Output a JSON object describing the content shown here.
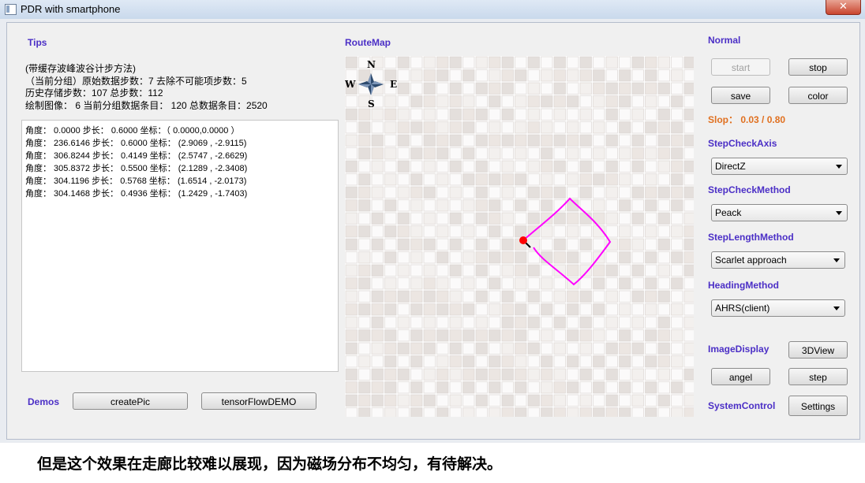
{
  "window": {
    "title": "PDR  with smartphone",
    "close_symbol": "✕"
  },
  "tips": {
    "label": "Tips",
    "lines": [
      "(带缓存波峰波谷计步方法)",
      "（当前分组）原始数据步数：7    去除不可能项步数：5",
      "历史存储步数：107     总步数：112",
      "绘制图像： 6     当前分组数据条目： 120     总数据条目：2520"
    ]
  },
  "log": {
    "lines": [
      "角度： 0.0000  步长： 0.6000  坐标：（ 0.0000,0.0000 ）",
      "角度： 236.6146  步长： 0.6000  坐标： (2.9069 , -2.9115)",
      "角度： 306.8244  步长： 0.4149  坐标： (2.5747 , -2.6629)",
      "角度： 305.8372  步长： 0.5500  坐标： (2.1289 , -2.3408)",
      "角度： 304.1196  步长： 0.5768  坐标： (1.6514 , -2.0173)",
      "角度： 304.1468  步长： 0.4936  坐标： (1.2429 , -1.7403)"
    ]
  },
  "demos": {
    "label": "Demos",
    "create_pic": "createPic",
    "tensorflow": "tensorFlowDEMO"
  },
  "routemap": {
    "label": "RouteMap",
    "compass": {
      "n": "N",
      "s": "S",
      "e": "E",
      "w": "W"
    },
    "path_color": "#ff00ff",
    "marker_color": "#ff0000"
  },
  "controls": {
    "normal_label": "Normal",
    "start": "start",
    "stop": "stop",
    "save": "save",
    "color": "color",
    "slop": "Slop： 0.03 / 0.80",
    "step_check_axis_label": "StepCheckAxis",
    "step_check_axis_value": "DirectZ",
    "step_check_method_label": "StepCheckMethod",
    "step_check_method_value": "Peack",
    "step_length_method_label": "StepLengthMethod",
    "step_length_method_value": "Scarlet approach",
    "heading_method_label": "HeadingMethod",
    "heading_method_value": "AHRS(client)",
    "image_display_label": "ImageDisplay",
    "view3d": "3DView",
    "angel": "angel",
    "step": "step",
    "system_control_label": "SystemControl",
    "settings": "Settings"
  },
  "caption": "但是这个效果在走廊比较难以展现，因为磁场分布不均匀，有待解决。"
}
